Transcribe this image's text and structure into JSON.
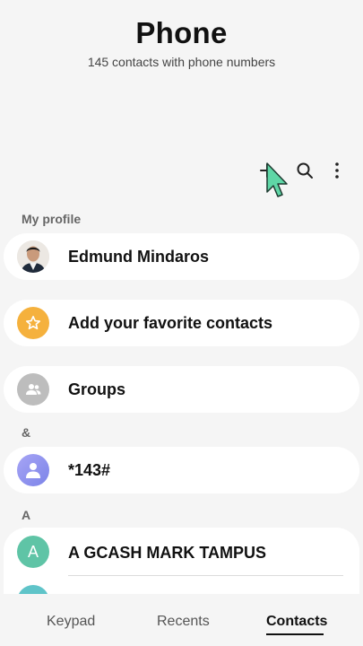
{
  "header": {
    "title": "Phone",
    "subtitle": "145 contacts with phone numbers"
  },
  "toolbar": {
    "add_icon": "plus-icon",
    "search_icon": "search-icon",
    "more_icon": "more-vertical-icon"
  },
  "sections": {
    "my_profile": "My profile",
    "ampersand": "&",
    "a": "A"
  },
  "profile": {
    "name": "Edmund Mindaros"
  },
  "favorites": {
    "label": "Add your favorite contacts",
    "color": "#f5b13d"
  },
  "groups": {
    "label": "Groups",
    "color": "#bdbdbd"
  },
  "contacts": [
    {
      "name": "*143#",
      "initial": "",
      "color": "#8d8ff0"
    },
    {
      "name": "A GCASH MARK TAMPUS",
      "initial": "A",
      "color": "#5fc4a6"
    },
    {
      "name": "",
      "initial": "",
      "color": "#5fc4c9"
    }
  ],
  "bottom_nav": {
    "tabs": [
      "Keypad",
      "Recents",
      "Contacts"
    ],
    "active": "Contacts"
  }
}
